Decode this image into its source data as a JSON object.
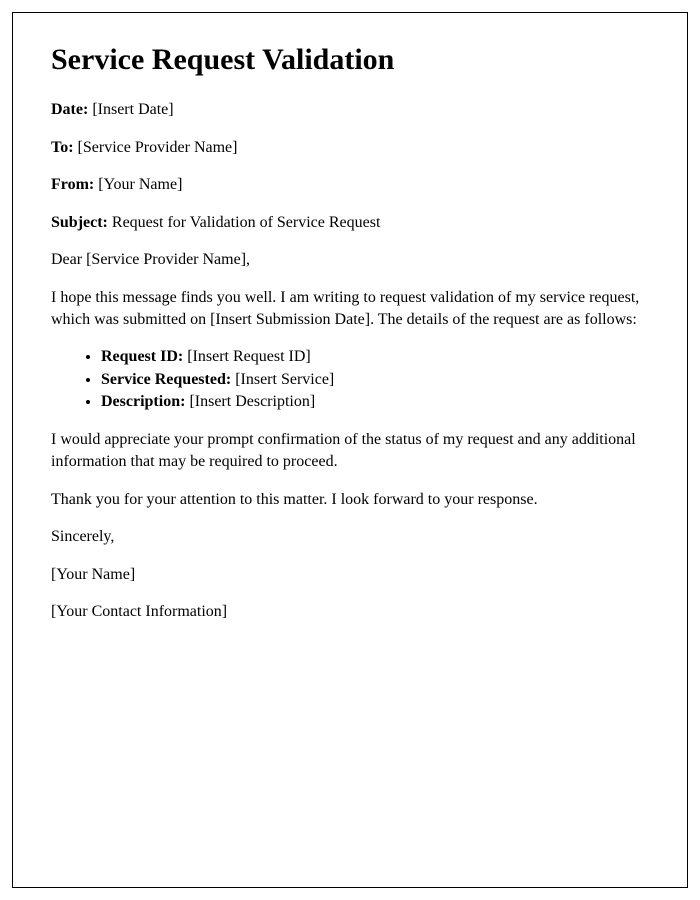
{
  "title": "Service Request Validation",
  "fields": {
    "date_label": "Date:",
    "date_value": " [Insert Date]",
    "to_label": "To:",
    "to_value": " [Service Provider Name]",
    "from_label": "From:",
    "from_value": " [Your Name]",
    "subject_label": "Subject:",
    "subject_value": " Request for Validation of Service Request"
  },
  "salutation": "Dear [Service Provider Name],",
  "intro_paragraph": "I hope this message finds you well. I am writing to request validation of my service request, which was submitted on [Insert Submission Date]. The details of the request are as follows:",
  "details": {
    "request_id_label": "Request ID:",
    "request_id_value": " [Insert Request ID]",
    "service_requested_label": "Service Requested:",
    "service_requested_value": " [Insert Service]",
    "description_label": "Description:",
    "description_value": " [Insert Description]"
  },
  "followup_paragraph": "I would appreciate your prompt confirmation of the status of my request and any additional information that may be required to proceed.",
  "thanks_paragraph": "Thank you for your attention to this matter. I look forward to your response.",
  "closing": "Sincerely,",
  "signature_name": "[Your Name]",
  "signature_contact": "[Your Contact Information]"
}
